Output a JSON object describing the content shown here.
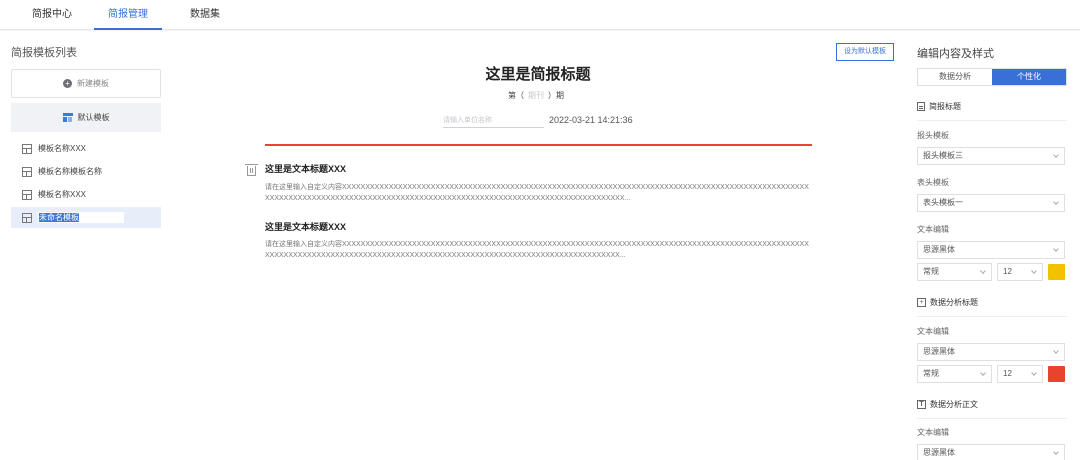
{
  "nav": {
    "tabs": [
      {
        "label": "简报中心",
        "active": false
      },
      {
        "label": "简报管理",
        "active": true
      },
      {
        "label": "数据集",
        "active": false
      }
    ]
  },
  "left": {
    "title": "简报模板列表",
    "new_button": "新建模板",
    "default_button": "默认模板",
    "templates": [
      {
        "label": "模板名称XXX",
        "selected": false
      },
      {
        "label": "模板名称模板名称",
        "selected": false
      },
      {
        "label": "模板名称XXX",
        "selected": false
      },
      {
        "label": "未命名模板",
        "selected": true,
        "editing": true
      }
    ]
  },
  "center": {
    "set_default_button": "设为默认模板",
    "report_title": "这里是简报标题",
    "issue_prefix": "第（",
    "issue_placeholder": "期刊",
    "issue_suffix": "）期",
    "unit_placeholder": "请输入单位名称",
    "date": "2022-03-21 14:21:36",
    "accent_color": "#e8432f",
    "sections": [
      {
        "title": "这里是文本标题XXX",
        "body": "请在这里输入自定义内容XXXXXXXXXXXXXXXXXXXXXXXXXXXXXXXXXXXXXXXXXXXXXXXXXXXXXXXXXXXXXXXXXXXXXXXXXXXXXXXXXXXXXXXXXXXXXXXXXXXXXXXXXXXXXXXXXXXXXXXXXXXXXXXXXXXXXXXXXXXXXXXXXXXXXXXXXXXXXXXXXXXXXXXXXXXXXXXXX..."
      },
      {
        "title": "这里是文本标题XXX",
        "body": "请在这里输入自定义内容XXXXXXXXXXXXXXXXXXXXXXXXXXXXXXXXXXXXXXXXXXXXXXXXXXXXXXXXXXXXXXXXXXXXXXXXXXXXXXXXXXXXXXXXXXXXXXXXXXXXXXXXXXXXXXXXXXXXXXXXXXXXXXXXXXXXXXXXXXXXXXXXXXXXXXXXXXXXXXXXXXXXXXXXXXXXXXXX..."
      }
    ]
  },
  "right": {
    "title": "编辑内容及样式",
    "seg_tabs": [
      {
        "label": "数据分析",
        "active": false
      },
      {
        "label": "个性化",
        "active": true
      }
    ],
    "report_title_section": {
      "heading": "简报标题",
      "header_template_label": "报头模板",
      "header_template_value": "报头模板三",
      "table_header_label": "表头模板",
      "table_header_value": "表头模板一",
      "text_edit_label": "文本编辑",
      "font": "思源黑体",
      "weight": "常规",
      "size": "12",
      "color": "#f2c200"
    },
    "analysis_title_section": {
      "heading": "数据分析标题",
      "text_edit_label": "文本编辑",
      "font": "思源黑体",
      "weight": "常规",
      "size": "12",
      "color": "#e8432f"
    },
    "analysis_body_section": {
      "heading": "数据分析正文",
      "text_edit_label": "文本编辑",
      "font": "思源黑体"
    }
  }
}
